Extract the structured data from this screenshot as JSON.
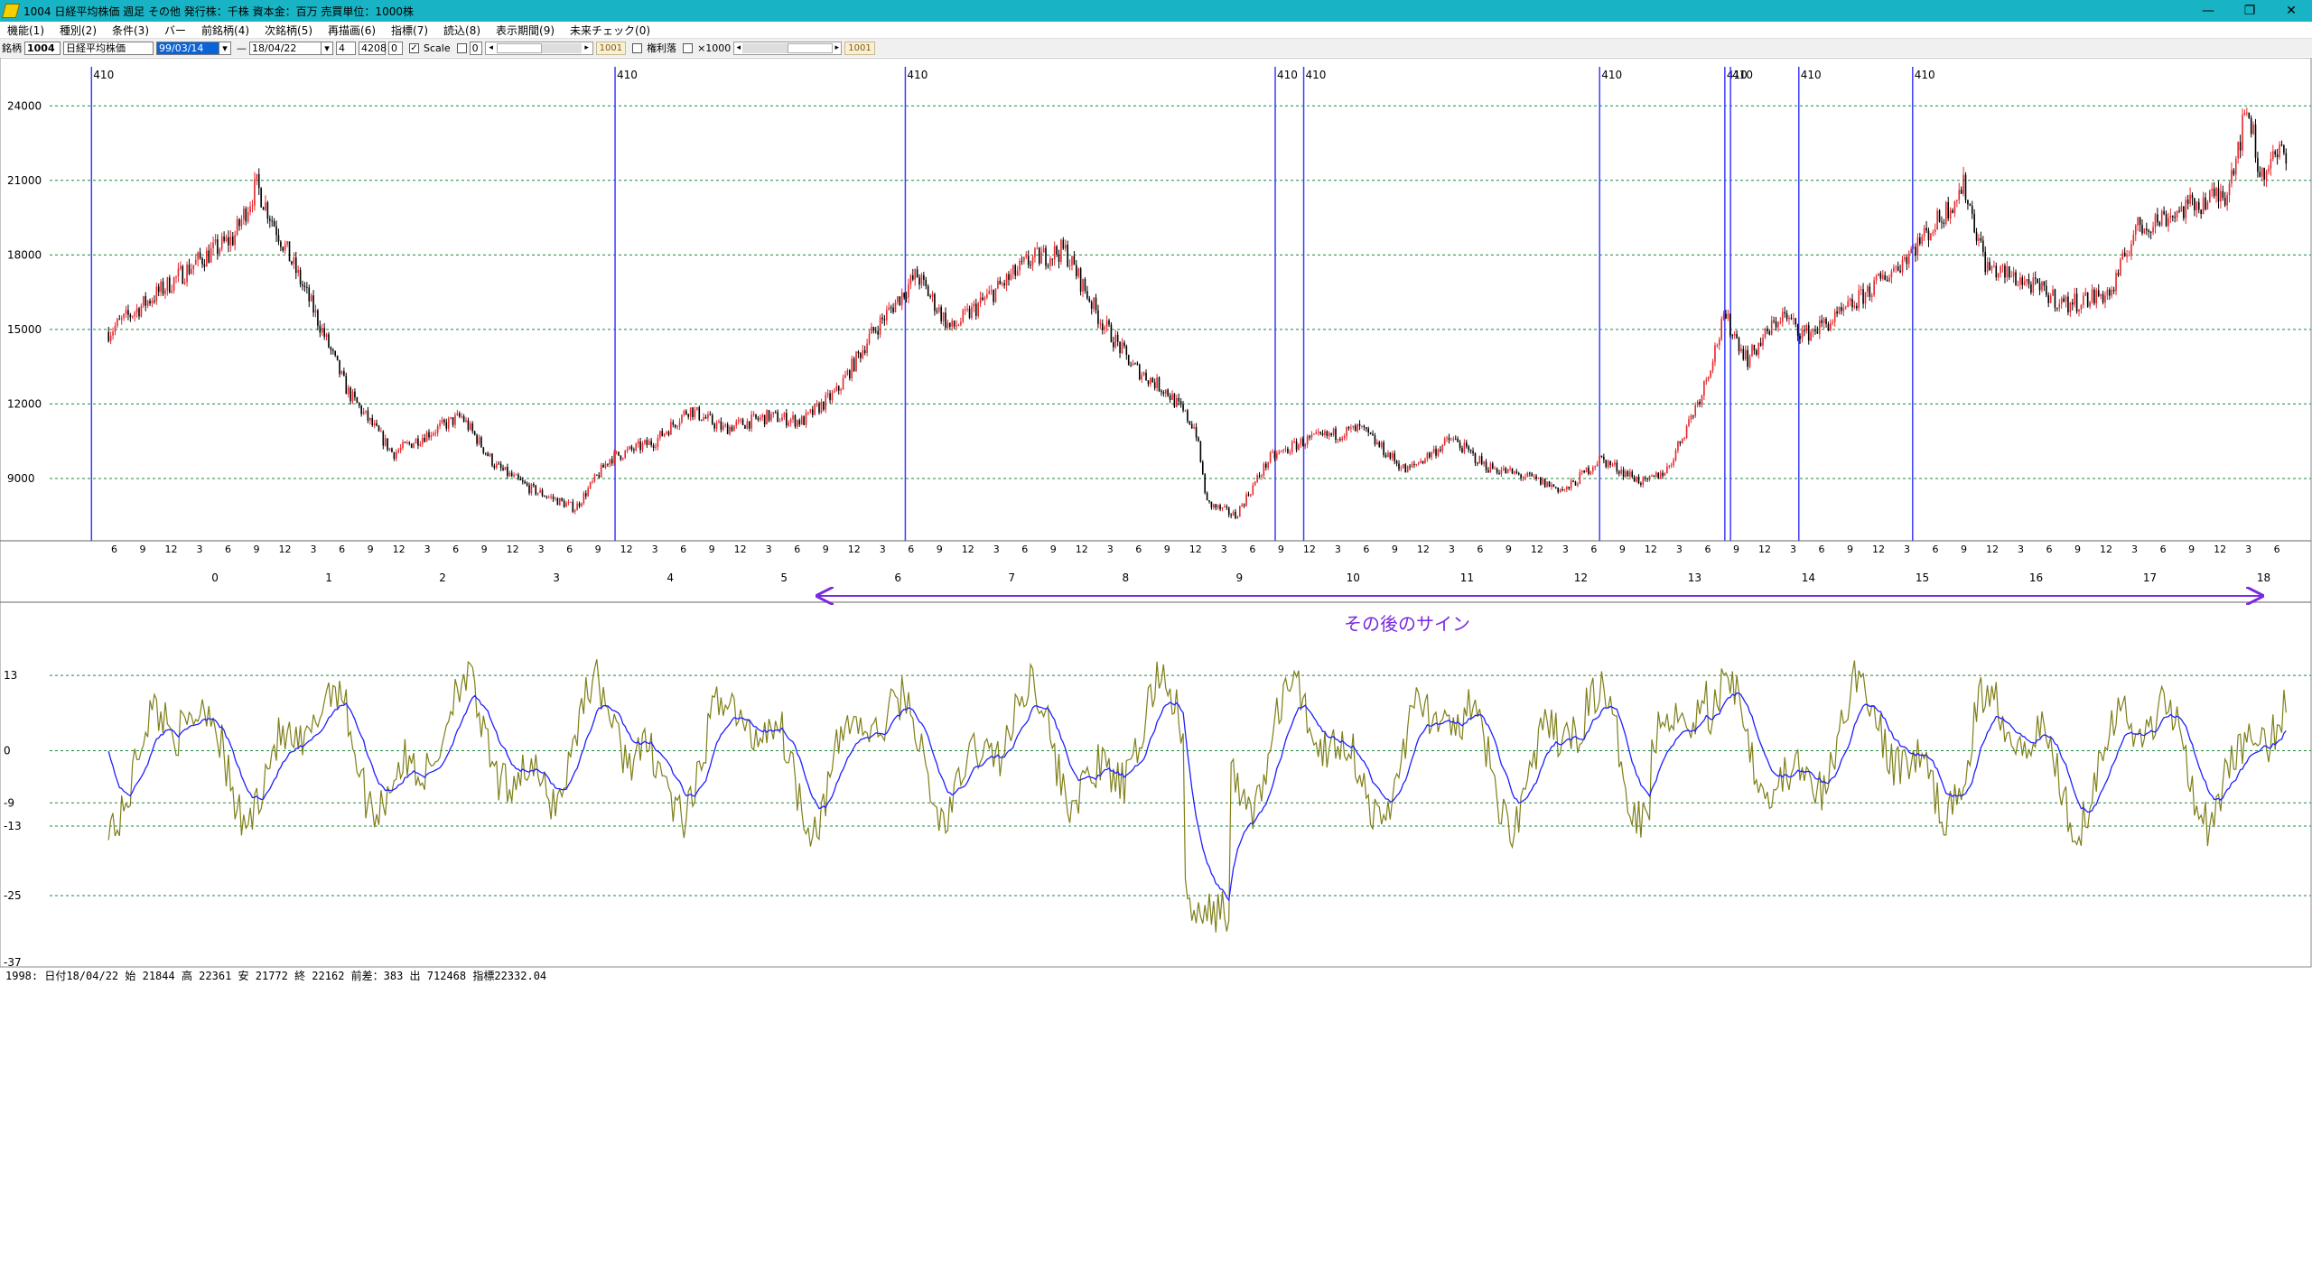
{
  "window": {
    "title": "1004 日経平均株価 週足 その他 発行株：千株 資本金：百万 売買単位：1000株",
    "minimize": "—",
    "restore": "❐",
    "close": "✕"
  },
  "menu": [
    "機能(1)",
    "種別(2)",
    "条件(3)",
    "バー",
    "前銘柄(4)",
    "次銘柄(5)",
    "再描画(6)",
    "指標(7)",
    "読込(8)",
    "表示期間(9)",
    "未来チェック(0)"
  ],
  "toolbar": {
    "code_label": "銘柄",
    "code": "1004",
    "name": "日経平均株価",
    "date_from": "99/03/14",
    "dash": "—",
    "date_to": "18/04/22",
    "field_a": "4",
    "field_b": "4208",
    "field_c": "0",
    "scale_label": "Scale",
    "scale_value": "0",
    "counter1": "1001",
    "dividend_label": "権利落",
    "mult_label": "×1000",
    "counter2": "1001"
  },
  "price_chart": {
    "y_ticks": [
      "24000",
      "21000",
      "18000",
      "15000",
      "12000",
      "9000"
    ],
    "y_values": [
      24000,
      21000,
      18000,
      15000,
      12000,
      9000
    ],
    "y_range": [
      6600,
      25500
    ],
    "marker_label": "410",
    "year_labels": [
      "0",
      "1",
      "2",
      "3",
      "4",
      "5",
      "6",
      "7",
      "8",
      "9",
      "10",
      "11",
      "12",
      "13",
      "14",
      "15",
      "16",
      "17",
      "18"
    ],
    "month_labels": [
      "6",
      "9",
      "12",
      "3"
    ],
    "colors": {
      "up": "#e8262c",
      "down": "#000000",
      "grid": "#1a8a3a",
      "marker": "#3c3cff"
    }
  },
  "chart_data": {
    "type": "line",
    "price": {
      "series": [
        {
          "name": "down",
          "color": "#000000"
        },
        {
          "name": "up",
          "color": "#e8262c"
        }
      ],
      "x_years": [
        1999.2,
        2000.0,
        2000.3,
        2000.5,
        2001.0,
        2001.3,
        2001.7,
        2002.0,
        2002.3,
        2002.6,
        2002.9,
        2003.3,
        2003.6,
        2004.0,
        2004.3,
        2004.6,
        2005.0,
        2005.3,
        2005.6,
        2005.9,
        2006.3,
        2006.6,
        2006.9,
        2007.3,
        2007.6,
        2007.9,
        2008.2,
        2008.5,
        2008.75,
        2008.85,
        2009.1,
        2009.4,
        2009.7,
        2010.2,
        2010.6,
        2011.0,
        2011.3,
        2011.7,
        2012.0,
        2012.3,
        2012.7,
        2012.9,
        2013.2,
        2013.4,
        2013.6,
        2013.9,
        2014.1,
        2014.4,
        2014.9,
        2015.3,
        2015.5,
        2015.7,
        2016.0,
        2016.4,
        2016.8,
        2017.0,
        2017.4,
        2017.8,
        2018.0,
        2018.1,
        2018.3
      ],
      "y_close": [
        14900,
        17800,
        18700,
        20800,
        15800,
        12500,
        10000,
        10800,
        11500,
        9500,
        8600,
        7800,
        9800,
        10500,
        11800,
        11000,
        11500,
        11300,
        12500,
        14800,
        17200,
        15000,
        16200,
        17800,
        18200,
        15500,
        13500,
        12500,
        11000,
        8000,
        7500,
        9800,
        10500,
        11000,
        9300,
        10600,
        9500,
        9000,
        8500,
        9800,
        8800,
        9400,
        12500,
        15500,
        13800,
        15600,
        14800,
        15500,
        17500,
        19500,
        20800,
        17500,
        17000,
        16000,
        16500,
        19000,
        19800,
        20500,
        24000,
        21200,
        22200
      ]
    },
    "indicator": {
      "y_ticks": [
        "13",
        "0",
        "-9",
        "-13",
        "-25",
        "-37"
      ],
      "y_values": [
        13,
        0,
        -9,
        -13,
        -25,
        -37
      ],
      "y_range": [
        -37,
        18
      ],
      "series": [
        {
          "name": "fast",
          "color": "#7f7f1a"
        },
        {
          "name": "signal",
          "color": "#1f1fff"
        }
      ]
    },
    "annotation": "その後のサイン"
  },
  "status": {
    "text": "1998:  日付18/04/22  始 21844  高 22361  安 21772  終 22162 前差：383  出 712468  指標22332.04"
  }
}
